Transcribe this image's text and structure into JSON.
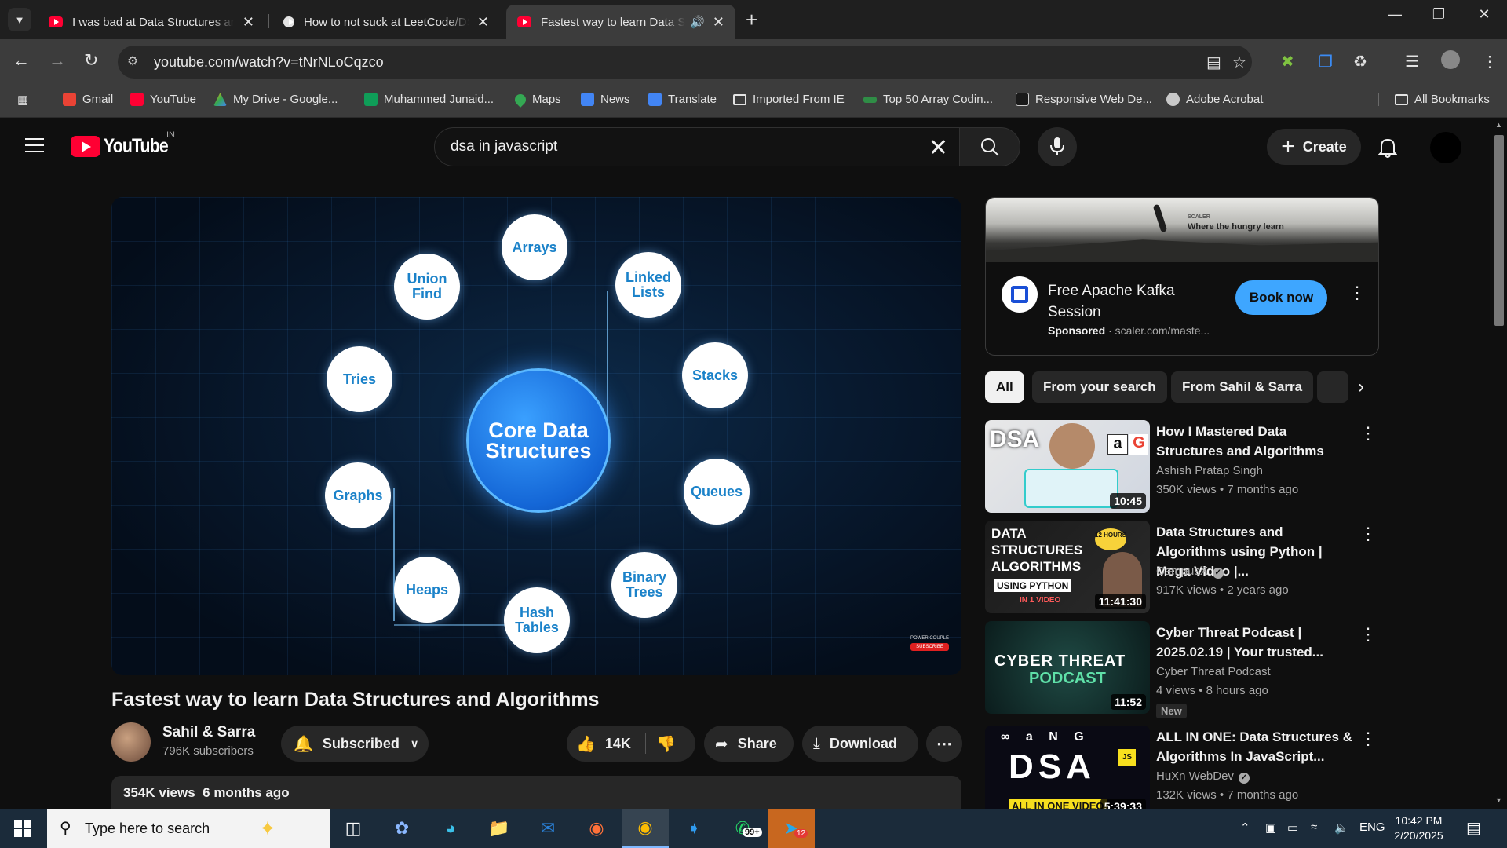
{
  "browser": {
    "tabs": [
      {
        "title": "I was bad at Data Structures and Algorithms"
      },
      {
        "title": "How to not suck at LeetCode/DSA"
      },
      {
        "title": "Fastest way to learn Data Structures"
      }
    ],
    "url": "youtube.com/watch?v=tNrNLoCqzco",
    "bookmarks": [
      {
        "label": "Gmail",
        "color": "#ea4335"
      },
      {
        "label": "YouTube",
        "color": "#ff0033"
      },
      {
        "label": "My Drive - Google...",
        "color": "#fbbc04"
      },
      {
        "label": "Muhammed Junaid...",
        "color": "#0f9d58"
      },
      {
        "label": "Maps",
        "color": "#34a853"
      },
      {
        "label": "News",
        "color": "#4285f4"
      },
      {
        "label": "Translate",
        "color": "#4285f4"
      },
      {
        "label": "Imported From IE",
        "color": "folder"
      },
      {
        "label": "Top 50 Array Codin...",
        "color": "#2f8d46"
      },
      {
        "label": "Responsive Web De...",
        "color": "#1a1a1a"
      },
      {
        "label": "Adobe Acrobat",
        "color": "#c8c8c8"
      }
    ],
    "all_bookmarks": "All Bookmarks"
  },
  "youtube": {
    "logo_text": "YouTube",
    "country_code": "IN",
    "search_query": "dsa in javascript",
    "create_label": "Create",
    "video": {
      "thumbnail_center": "Core Data Structures",
      "nodes": [
        "Arrays",
        "Linked Lists",
        "Stacks",
        "Queues",
        "Binary Trees",
        "Hash Tables",
        "Heaps",
        "Graphs",
        "Tries",
        "Union Find"
      ],
      "watermark_top": "POWER COUPLE",
      "watermark_bottom": "SUBSCRIBE",
      "title": "Fastest way to learn Data Structures and Algorithms",
      "channel": "Sahil & Sarra",
      "subscribers": "796K subscribers",
      "subscribed_label": "Subscribed",
      "likes": "14K",
      "share_label": "Share",
      "download_label": "Download",
      "views": "354K views",
      "age": "6 months ago"
    },
    "ad": {
      "banner_brand": "SCALER",
      "banner_tagline": "Where the hungry learn",
      "headline": "Free Apache Kafka Session",
      "sponsored": "Sponsored",
      "domain": "scaler.com/maste...",
      "cta": "Book now"
    },
    "chips": [
      "All",
      "From your search",
      "From Sahil & Sarra"
    ],
    "recommendations": [
      {
        "title": "How I Mastered Data Structures and Algorithms",
        "channel": "Ashish Pratap Singh",
        "views": "350K views",
        "age": "7 months ago",
        "duration": "10:45",
        "verified": false,
        "badge": ""
      },
      {
        "title": "Data Structures and Algorithms using Python | Mega Video |...",
        "channel": "CampusX",
        "views": "917K views",
        "age": "2 years ago",
        "duration": "11:41:30",
        "verified": true,
        "badge": ""
      },
      {
        "title": "Cyber Threat Podcast | 2025.02.19 | Your trusted...",
        "channel": "Cyber Threat Podcast",
        "views": "4 views",
        "age": "8 hours ago",
        "duration": "11:52",
        "verified": false,
        "badge": "New"
      },
      {
        "title": "ALL IN ONE: Data Structures & Algorithms In JavaScript...",
        "channel": "HuXn WebDev",
        "views": "132K views",
        "age": "7 months ago",
        "duration": "5:39:33",
        "verified": true,
        "badge": ""
      }
    ],
    "thumb_text": {
      "r1": "DSA",
      "r2_lines": [
        "DATA",
        "STRUCTURES",
        "ALGORITHMS"
      ],
      "r2_sub": "USING PYTHON",
      "r2_sub2": "IN 1 VIDEO",
      "r2_hours": "12 HOURS",
      "r3_line1": "CYBER THREAT",
      "r3_line2": "PODCAST",
      "r4_main": "DSA",
      "r4_sub": "ALL IN ONE VIDEO"
    }
  },
  "taskbar": {
    "search_placeholder": "Type here to search",
    "whatsapp_badge": "99+",
    "telegram_badge": "12",
    "language": "ENG",
    "time": "10:42 PM",
    "date": "2/20/2025"
  }
}
